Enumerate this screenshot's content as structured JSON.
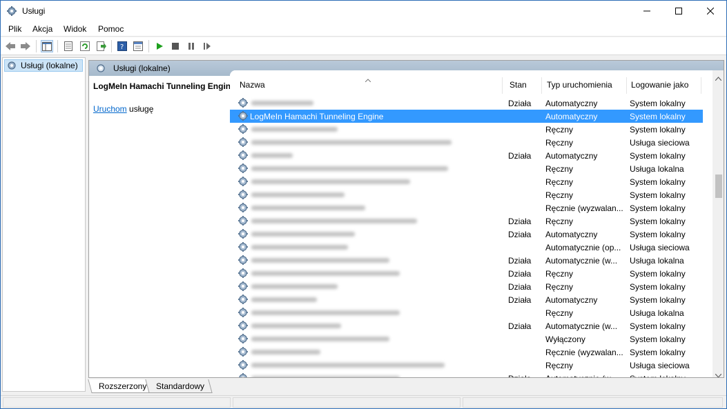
{
  "window": {
    "title": "Usługi"
  },
  "menu": [
    "Plik",
    "Akcja",
    "Widok",
    "Pomoc"
  ],
  "toolbar": {
    "icons": [
      "back-icon",
      "forward-icon",
      "show-tree-icon",
      "properties-icon",
      "refresh-icon",
      "export-icon",
      "help-icon",
      "console-icon",
      "start-icon",
      "stop-icon",
      "pause-icon",
      "resume-icon"
    ]
  },
  "tree": {
    "root_label": "Usługi (lokalne)"
  },
  "main": {
    "header_title": "Usługi (lokalne)",
    "selected_service": "LogMeIn Hamachi Tunneling Engine",
    "start_link": "Uruchom",
    "start_suffix": " usługę"
  },
  "columns": {
    "name": "Nazwa",
    "state": "Stan",
    "startup": "Typ uruchomienia",
    "logon": "Logowanie jako"
  },
  "services": [
    {
      "name": "",
      "state": "Działa",
      "startup": "Automatyczny",
      "logon": "System lokalny",
      "blur": 90,
      "selected": false
    },
    {
      "name": "LogMeIn Hamachi Tunneling Engine",
      "state": "",
      "startup": "Automatyczny",
      "logon": "System lokalny",
      "blur": 0,
      "selected": true
    },
    {
      "name": "",
      "state": "",
      "startup": "Ręczny",
      "logon": "System lokalny",
      "blur": 125,
      "selected": false
    },
    {
      "name": "",
      "state": "",
      "startup": "Ręczny",
      "logon": "Usługa sieciowa",
      "blur": 290,
      "selected": false
    },
    {
      "name": "",
      "state": "Działa",
      "startup": "Automatyczny",
      "logon": "System lokalny",
      "blur": 60,
      "selected": false
    },
    {
      "name": "",
      "state": "",
      "startup": "Ręczny",
      "logon": "Usługa lokalna",
      "blur": 285,
      "selected": false
    },
    {
      "name": "",
      "state": "",
      "startup": "Ręczny",
      "logon": "System lokalny",
      "blur": 230,
      "selected": false
    },
    {
      "name": "",
      "state": "",
      "startup": "Ręczny",
      "logon": "System lokalny",
      "blur": 135,
      "selected": false
    },
    {
      "name": "",
      "state": "",
      "startup": "Ręcznie (wyzwalan...",
      "logon": "System lokalny",
      "blur": 165,
      "selected": false
    },
    {
      "name": "",
      "state": "Działa",
      "startup": "Ręczny",
      "logon": "System lokalny",
      "blur": 240,
      "selected": false
    },
    {
      "name": "",
      "state": "Działa",
      "startup": "Automatyczny",
      "logon": "System lokalny",
      "blur": 150,
      "selected": false
    },
    {
      "name": "",
      "state": "",
      "startup": "Automatycznie (op...",
      "logon": "Usługa sieciowa",
      "blur": 140,
      "selected": false
    },
    {
      "name": "",
      "state": "Działa",
      "startup": "Automatycznie (w...",
      "logon": "Usługa lokalna",
      "blur": 200,
      "selected": false
    },
    {
      "name": "",
      "state": "Działa",
      "startup": "Ręczny",
      "logon": "System lokalny",
      "blur": 215,
      "selected": false
    },
    {
      "name": "",
      "state": "Działa",
      "startup": "Ręczny",
      "logon": "System lokalny",
      "blur": 125,
      "selected": false
    },
    {
      "name": "",
      "state": "Działa",
      "startup": "Automatyczny",
      "logon": "System lokalny",
      "blur": 95,
      "selected": false
    },
    {
      "name": "",
      "state": "",
      "startup": "Ręczny",
      "logon": "Usługa lokalna",
      "blur": 215,
      "selected": false
    },
    {
      "name": "",
      "state": "Działa",
      "startup": "Automatycznie (w...",
      "logon": "System lokalny",
      "blur": 130,
      "selected": false
    },
    {
      "name": "",
      "state": "",
      "startup": "Wyłączony",
      "logon": "System lokalny",
      "blur": 200,
      "selected": false
    },
    {
      "name": "",
      "state": "",
      "startup": "Ręcznie (wyzwalan...",
      "logon": "System lokalny",
      "blur": 100,
      "selected": false
    },
    {
      "name": "",
      "state": "",
      "startup": "Ręczny",
      "logon": "Usługa sieciowa",
      "blur": 280,
      "selected": false
    },
    {
      "name": "",
      "state": "Działa",
      "startup": "Automatycznie (w...",
      "logon": "System lokalny",
      "blur": 215,
      "selected": false
    }
  ],
  "tabs": [
    "Rozszerzony",
    "Standardowy"
  ],
  "colors": {
    "selection": "#3399ff",
    "link": "#0066cc",
    "header_gradient": "#a6bacc"
  }
}
